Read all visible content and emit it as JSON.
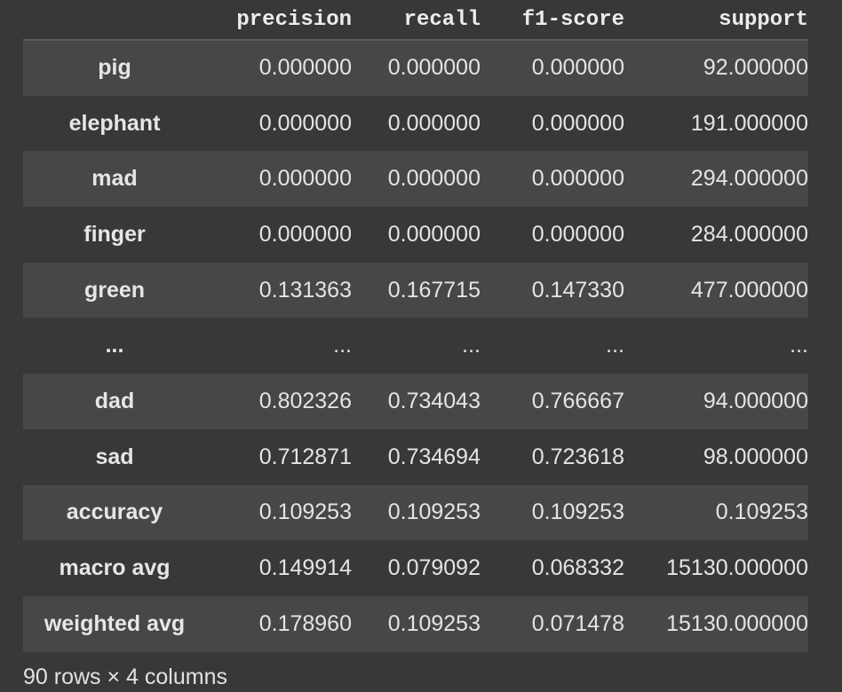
{
  "table": {
    "columns": [
      "precision",
      "recall",
      "f1-score",
      "support"
    ],
    "rows": [
      {
        "label": "pig",
        "values": [
          "0.000000",
          "0.000000",
          "0.000000",
          "92.000000"
        ]
      },
      {
        "label": "elephant",
        "values": [
          "0.000000",
          "0.000000",
          "0.000000",
          "191.000000"
        ]
      },
      {
        "label": "mad",
        "values": [
          "0.000000",
          "0.000000",
          "0.000000",
          "294.000000"
        ]
      },
      {
        "label": "finger",
        "values": [
          "0.000000",
          "0.000000",
          "0.000000",
          "284.000000"
        ]
      },
      {
        "label": "green",
        "values": [
          "0.131363",
          "0.167715",
          "0.147330",
          "477.000000"
        ]
      },
      {
        "label": "...",
        "values": [
          "...",
          "...",
          "...",
          "..."
        ]
      },
      {
        "label": "dad",
        "values": [
          "0.802326",
          "0.734043",
          "0.766667",
          "94.000000"
        ]
      },
      {
        "label": "sad",
        "values": [
          "0.712871",
          "0.734694",
          "0.723618",
          "98.000000"
        ]
      },
      {
        "label": "accuracy",
        "values": [
          "0.109253",
          "0.109253",
          "0.109253",
          "0.109253"
        ]
      },
      {
        "label": "macro avg",
        "values": [
          "0.149914",
          "0.079092",
          "0.068332",
          "15130.000000"
        ]
      },
      {
        "label": "weighted avg",
        "values": [
          "0.178960",
          "0.109253",
          "0.071478",
          "15130.000000"
        ]
      }
    ]
  },
  "footer": {
    "shape_text": "90 rows × 4 columns"
  }
}
